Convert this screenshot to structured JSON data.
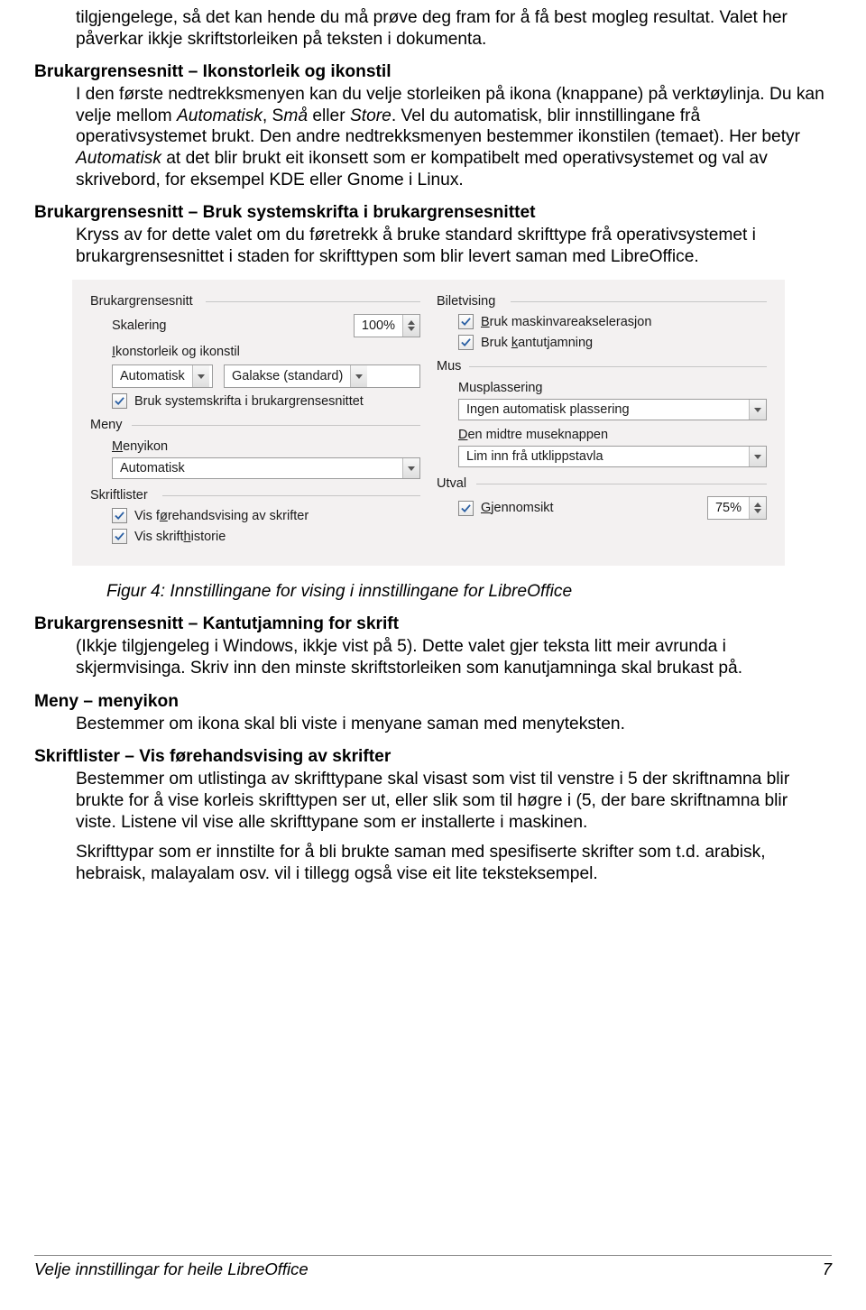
{
  "para_intro": "tilgjengelege, så det kan hende du må prøve deg fram for å få best mogleg resultat. Valet her påverkar ikkje skriftstorleiken på teksten i dokumenta.",
  "section_ikon": {
    "heading": "Brukargrensesnitt –  Ikonstorleik og ikonstil",
    "body_parts": [
      "I den første nedtrekksmenyen kan du velje storleiken på ikona (knappane) på verktøylinja. Du kan velje mellom ",
      "Automatisk",
      ", S",
      "må",
      " eller ",
      "Store",
      ". Vel du automatisk, blir innstillingane frå operativsystemet brukt. Den andre nedtrekksmenyen bestemmer ikonstilen (temaet). Her betyr ",
      "Automatisk",
      " at det blir brukt eit ikonsett som er kompatibelt med operativsystemet og val av skrivebord, for eksempel KDE eller Gnome i Linux."
    ]
  },
  "section_systemskrift": {
    "heading": "Brukargrensesnitt – Bruk systemskrifta i brukargrensesnittet",
    "body": "Kryss av for dette valet om du føretrekk å bruke standard skrifttype frå operativsystemet i brukargrensesnittet i staden for skrifttypen som blir levert saman med LibreOffice."
  },
  "figure": {
    "left": {
      "group_ui": "Brukargrensesnitt",
      "skalering_label": "Skalering",
      "skalering_value": "100%",
      "ikon_label_pre": "I",
      "ikon_label_rest": "konstorleik og ikonstil",
      "combo_size": "Automatisk",
      "combo_theme": "Galakse (standard)",
      "chk_systemskrift": "Bruk systemskrifta i brukargrensesnittet",
      "group_meny": "Meny",
      "menyikon_pre": "M",
      "menyikon_rest": "enyikon",
      "combo_menyikon": "Automatisk",
      "group_skriftlister": "Skriftlister",
      "chk_preview_pre": "Vis f",
      "chk_preview_mn": "ø",
      "chk_preview_rest": "rehandsvising av skrifter",
      "chk_history_pre": "Vis skrift",
      "chk_history_mn": "h",
      "chk_history_rest": "istorie"
    },
    "right": {
      "group_bilet": "Biletvising",
      "chk_hw_pre": "Bruk maskinvareakselerasjon",
      "chk_hw_mn": "B",
      "chk_kant_pre": "Bruk ",
      "chk_kant_mn": "k",
      "chk_kant_rest": "antutjamning",
      "group_mus": "Mus",
      "mus_plass_label": "Musplassering",
      "combo_mus_plass": "Ingen automatisk plassering",
      "mus_mid_pre": "D",
      "mus_mid_rest": "en midtre museknappen",
      "combo_mus_mid": "Lim inn frå utklippstavla",
      "group_utval": "Utval",
      "chk_gjen_mn": "G",
      "chk_gjen_rest": "jennomsikt",
      "spin_utval": "75%"
    }
  },
  "caption": "Figur 4: Innstillingane for vising i innstillingane for LibreOffice",
  "section_kant": {
    "heading": "Brukargrensesnitt –  Kantutjamning for skrift",
    "body": "(Ikkje tilgjengeleg i Windows, ikkje vist på 5). Dette valet gjer teksta litt meir avrunda i skjermvisinga. Skriv inn den minste skriftstorleiken som kanutjamninga skal brukast på."
  },
  "section_menyikon": {
    "heading": "Meny – menyikon",
    "body": "Bestemmer om ikona skal bli viste i menyane saman med menyteksten."
  },
  "section_preview": {
    "heading": "Skriftlister – Vis førehandsvising av skrifter",
    "body1": "Bestemmer om utlistinga av skrifttypane skal visast som vist til venstre i 5 der skriftnamna blir brukte for å vise korleis skrifttypen ser ut, eller slik som til høgre i (5, der bare skriftnamna blir viste. Listene vil vise alle skrifttypane som er installerte i maskinen.",
    "body2": "Skrifttypar som er innstilte for å bli brukte saman med spesifiserte skrifter som t.d. arabisk, hebraisk, malayalam osv. vil i tillegg også vise eit lite teksteksempel."
  },
  "footer": {
    "title": "Velje  innstillingar for heile LibreOffice",
    "page": "7"
  }
}
